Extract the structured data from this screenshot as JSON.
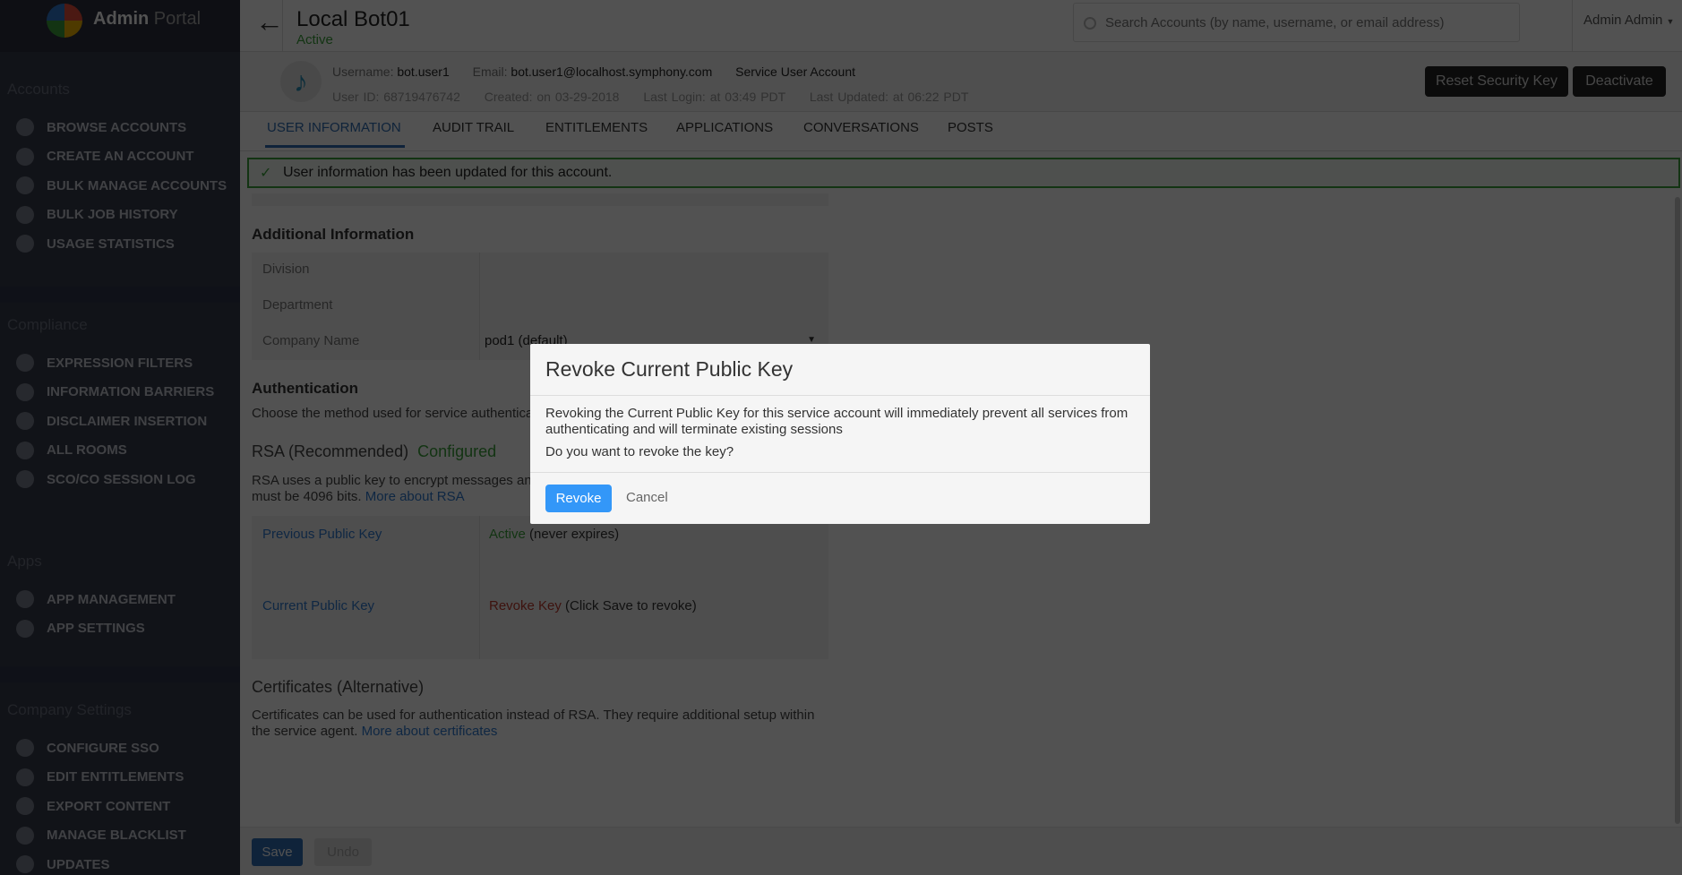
{
  "app": {
    "logo_bold": "Admin",
    "logo_light": "Portal"
  },
  "sidebar": {
    "sections": [
      {
        "title": "Accounts",
        "items": [
          "BROWSE ACCOUNTS",
          "CREATE AN ACCOUNT",
          "BULK MANAGE ACCOUNTS",
          "BULK JOB HISTORY",
          "USAGE STATISTICS"
        ]
      },
      {
        "title": "Compliance",
        "items": [
          "EXPRESSION FILTERS",
          "INFORMATION BARRIERS",
          "DISCLAIMER INSERTION",
          "ALL ROOMS",
          "SCO/CO SESSION LOG"
        ]
      },
      {
        "title": "Apps",
        "items": [
          "APP MANAGEMENT",
          "APP SETTINGS"
        ]
      },
      {
        "title": "Company Settings",
        "items": [
          "CONFIGURE SSO",
          "EDIT ENTITLEMENTS",
          "EXPORT CONTENT",
          "MANAGE BLACKLIST",
          "UPDATES"
        ]
      }
    ]
  },
  "header": {
    "title": "Local Bot01",
    "status": "Active",
    "search_placeholder": "Search Accounts (by name, username, or email address)",
    "user": "Admin Admin"
  },
  "account": {
    "username_label": "Username:",
    "username": "bot.user1",
    "email_label": "Email:",
    "email": "bot.user1@localhost.symphony.com",
    "type": "Service User Account",
    "user_id": "User ID: 68719476742",
    "created": "Created: on 03-29-2018",
    "last_login": "Last Login: at 03:49 PDT",
    "last_updated": "Last Updated: at 06:22 PDT",
    "reset_key": "Reset Security Key",
    "deactivate": "Deactivate"
  },
  "tabs": [
    "USER INFORMATION",
    "AUDIT TRAIL",
    "ENTITLEMENTS",
    "APPLICATIONS",
    "CONVERSATIONS",
    "POSTS"
  ],
  "alert": "User information has been updated for this account.",
  "content": {
    "additional_title": "Additional Information",
    "division": "Division",
    "department": "Department",
    "company": "Company Name",
    "company_value": "pod1 (default)",
    "auth_title": "Authentication",
    "auth_desc": "Choose the method used for service authentication.",
    "rsa_title": "RSA (Recommended)",
    "rsa_status": "Configured",
    "rsa_desc1": "RSA uses a public key to encrypt messages and authenticate. The key",
    "rsa_desc2": "must be 4096 bits.",
    "rsa_link": "More about RSA",
    "prev_key": "Previous Public Key",
    "prev_status": "Active",
    "prev_note": "(never expires)",
    "cur_key": "Current Public Key",
    "cur_action": "Revoke Key",
    "cur_note": "(Click Save to revoke)",
    "cert_title": "Certificates (Alternative)",
    "cert_desc1": "Certificates can be used for authentication instead of RSA. They require additional setup within",
    "cert_desc2": "the service agent.",
    "cert_link": "More about certificates",
    "save": "Save",
    "undo": "Undo"
  },
  "modal": {
    "title": "Revoke Current Public Key",
    "body1": "Revoking the Current Public Key for this service account will immediately prevent all services from",
    "body2": "authenticating and will terminate existing sessions",
    "question": "Do you want to revoke the key?",
    "revoke": "Revoke",
    "cancel": "Cancel"
  },
  "colors": {
    "accent": "#3397f8",
    "success": "#3aa33a",
    "danger": "#c0392b",
    "link": "#2e7ad1"
  }
}
